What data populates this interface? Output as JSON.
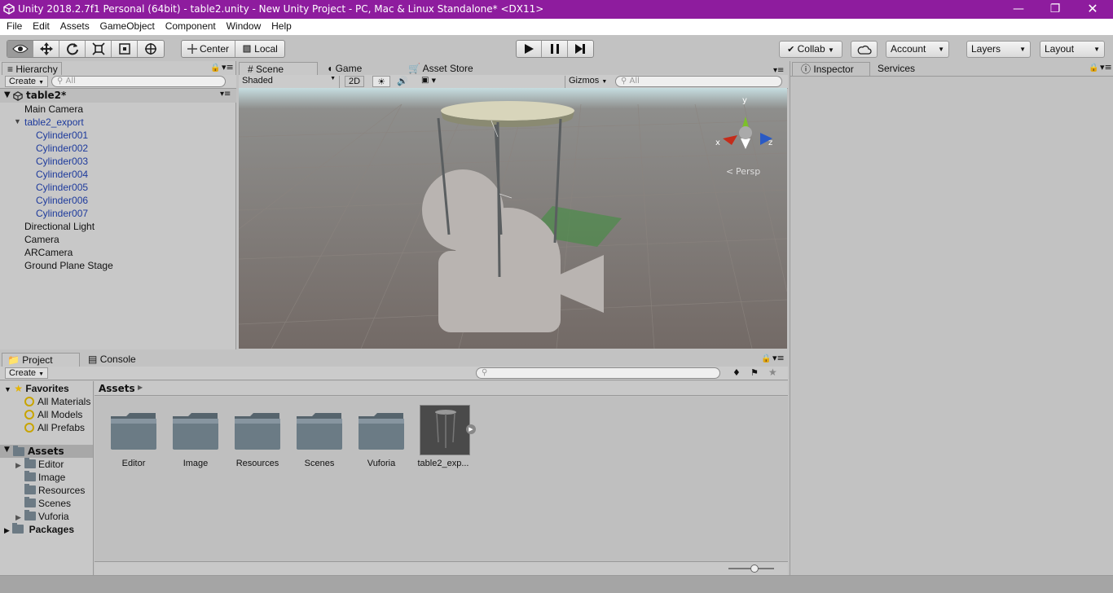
{
  "window": {
    "title": "Unity 2018.2.7f1 Personal (64bit) - table2.unity - New Unity Project - PC, Mac & Linux Standalone* <DX11>"
  },
  "menu": [
    "File",
    "Edit",
    "Assets",
    "GameObject",
    "Component",
    "Window",
    "Help"
  ],
  "toolbar": {
    "pivot_label": "Center",
    "space_label": "Local",
    "collab_label": "Collab",
    "account_label": "Account",
    "layers_label": "Layers",
    "layout_label": "Layout"
  },
  "hierarchy": {
    "tab_label": "Hierarchy",
    "create_label": "Create",
    "search_placeholder": "All",
    "scene_name": "table2*",
    "items": [
      {
        "label": "Main Camera",
        "indent": 0,
        "color": "normal"
      },
      {
        "label": "table2_export",
        "indent": 0,
        "color": "blue",
        "expanded": true
      },
      {
        "label": "Cylinder001",
        "indent": 1,
        "color": "blue"
      },
      {
        "label": "Cylinder002",
        "indent": 1,
        "color": "blue"
      },
      {
        "label": "Cylinder003",
        "indent": 1,
        "color": "blue"
      },
      {
        "label": "Cylinder004",
        "indent": 1,
        "color": "blue"
      },
      {
        "label": "Cylinder005",
        "indent": 1,
        "color": "blue"
      },
      {
        "label": "Cylinder006",
        "indent": 1,
        "color": "blue"
      },
      {
        "label": "Cylinder007",
        "indent": 1,
        "color": "blue"
      },
      {
        "label": "Directional Light",
        "indent": 0,
        "color": "normal"
      },
      {
        "label": "Camera",
        "indent": 0,
        "color": "normal"
      },
      {
        "label": "ARCamera",
        "indent": 0,
        "color": "normal"
      },
      {
        "label": "Ground Plane Stage",
        "indent": 0,
        "color": "normal"
      }
    ]
  },
  "scene": {
    "tabs": [
      "Scene",
      "Game",
      "Asset Store"
    ],
    "shading_label": "Shaded",
    "mode_2d_label": "2D",
    "gizmos_label": "Gizmos",
    "search_placeholder": "All",
    "persp_label": "Persp",
    "axis_y": "y",
    "axis_x": "x",
    "axis_z": "z"
  },
  "inspector": {
    "tabs": [
      "Inspector",
      "Services"
    ]
  },
  "project": {
    "tabs": [
      "Project",
      "Console"
    ],
    "create_label": "Create",
    "favorites_label": "Favorites",
    "favorites": [
      "All Materials",
      "All Models",
      "All Prefabs"
    ],
    "assets_label": "Assets",
    "asset_tree": [
      {
        "label": "Editor",
        "has_children": true
      },
      {
        "label": "Image",
        "has_children": false
      },
      {
        "label": "Resources",
        "has_children": false
      },
      {
        "label": "Scenes",
        "has_children": false
      },
      {
        "label": "Vuforia",
        "has_children": true
      }
    ],
    "packages_label": "Packages",
    "breadcrumb": "Assets",
    "grid_items": [
      {
        "label": "Editor",
        "kind": "folder"
      },
      {
        "label": "Image",
        "kind": "folder"
      },
      {
        "label": "Resources",
        "kind": "folder"
      },
      {
        "label": "Scenes",
        "kind": "folder"
      },
      {
        "label": "Vuforia",
        "kind": "folder"
      },
      {
        "label": "table2_exp...",
        "kind": "model"
      }
    ]
  },
  "colors": {
    "titlebar": "#8e1c9e",
    "editor_bg": "#c2c2c2",
    "selection_blue": "#1d3a9c"
  }
}
